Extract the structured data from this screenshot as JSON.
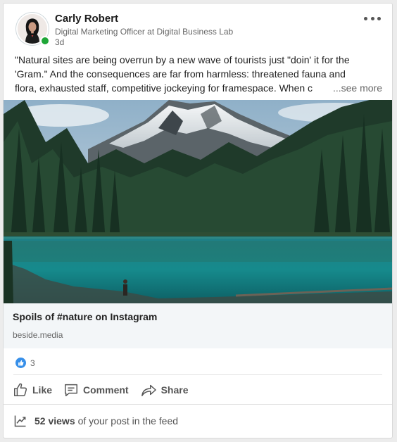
{
  "post": {
    "author": {
      "name": "Carly Robert",
      "headline": "Digital Marketing Officer at Digital Business Lab",
      "time": "3d",
      "avatar_icon": "profile-photo",
      "presence_color": "#1fa637"
    },
    "menu_icon": "more-horizontal-icon",
    "text_lines": [
      "\"Natural sites are being overrun by a new wave of tourists just \"doin' it for the",
      "'Gram.\" And the consequences are far from harmless: threatened fauna and",
      "flora, exhausted staff, competitive jockeying for framespace. When c"
    ],
    "see_more": "...see more",
    "link": {
      "title": "Spoils of #nature on Instagram",
      "domain": "beside.media"
    },
    "reactions": {
      "count": "3",
      "icon": "like-reaction-icon",
      "color": "#378fe9"
    },
    "actions": {
      "like": "Like",
      "comment": "Comment",
      "share": "Share"
    },
    "views": {
      "count": "52 views",
      "suffix": "of your post in the feed"
    }
  }
}
